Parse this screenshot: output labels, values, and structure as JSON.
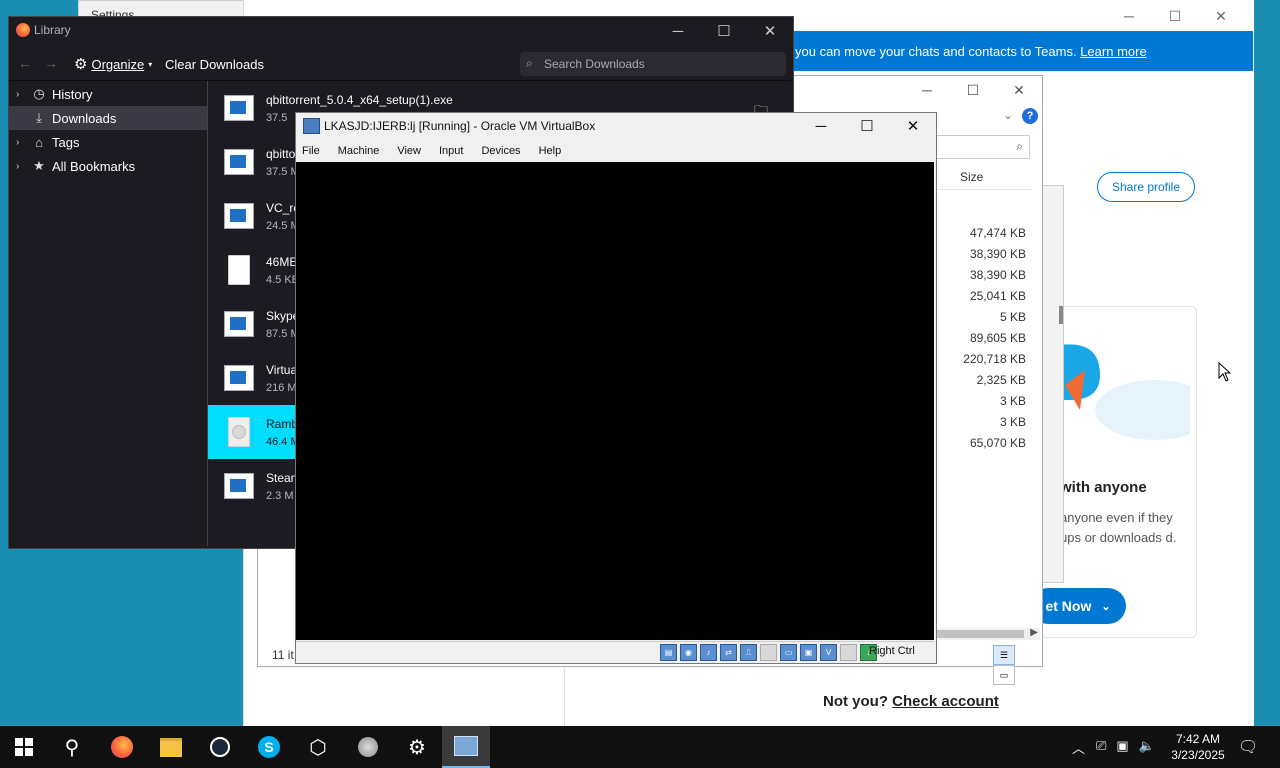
{
  "settings_window": {
    "title": "Settings"
  },
  "skype": {
    "banner_text": "you can move your chats and contacts to Teams.",
    "banner_link": "Learn more",
    "share_profile": "Share profile",
    "card_heading": "with anyone",
    "card_desc": "anyone even if they ups or downloads d.",
    "get_now": "et Now",
    "not_you": "Not you?",
    "check_account": "Check account"
  },
  "explorer": {
    "column_size": "Size",
    "sizes": [
      "47,474 KB",
      "38,390 KB",
      "38,390 KB",
      "25,041 KB",
      "5 KB",
      "89,605 KB",
      "220,718 KB",
      "2,325 KB",
      "3 KB",
      "3 KB",
      "65,070 KB"
    ],
    "status": "11 it"
  },
  "library": {
    "title": "Library",
    "toolbar": {
      "organize": "Organize",
      "clear_downloads": "Clear Downloads",
      "search_placeholder": "Search Downloads"
    },
    "nav": [
      {
        "label": "History",
        "icon": "clock-icon"
      },
      {
        "label": "Downloads",
        "icon": "download-icon"
      },
      {
        "label": "Tags",
        "icon": "tag-icon"
      },
      {
        "label": "All Bookmarks",
        "icon": "star-icon"
      }
    ],
    "downloads": [
      {
        "name": "qbittorrent_5.0.4_x64_setup(1).exe",
        "size": "37.5"
      },
      {
        "name": "qbitto",
        "size": "37.5 M"
      },
      {
        "name": "VC_re",
        "size": "24.5 M"
      },
      {
        "name": "46ME",
        "size": "4.5 KB"
      },
      {
        "name": "Skype",
        "size": "87.5 M"
      },
      {
        "name": "Virtua",
        "size": "216 M"
      },
      {
        "name": "Ramb",
        "size": "46.4 M"
      },
      {
        "name": "Steam",
        "size": "2.3 M"
      }
    ]
  },
  "vbox": {
    "title": "LKASJD:IJERB:lj [Running] - Oracle VM VirtualBox",
    "menu": [
      "File",
      "Machine",
      "View",
      "Input",
      "Devices",
      "Help"
    ],
    "host_key": "Right Ctrl"
  },
  "taskbar": {
    "time": "7:42 AM",
    "date": "3/23/2025"
  }
}
